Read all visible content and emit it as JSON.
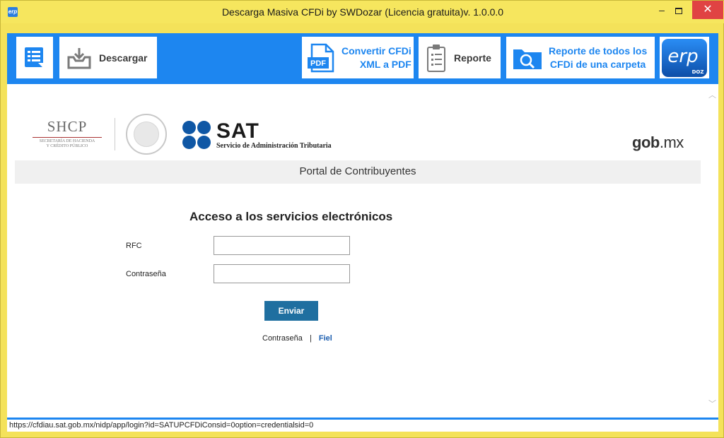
{
  "window": {
    "title": "Descarga Masiva CFDi by SWDozar (Licencia gratuita)v. 1.0.0.0",
    "app_icon_text": "erp",
    "minimize": "‒",
    "close": "✕"
  },
  "toolbar": {
    "descargar_label": "Descargar",
    "convertir_label_line1": "Convertir CFDi",
    "convertir_label_line2": "XML a PDF",
    "pdf_icon_text": "PDF",
    "reporte_label": "Reporte",
    "reporte_carpeta_line1": "Reporte de todos los",
    "reporte_carpeta_line2": "CFDi de una carpeta",
    "logo_text": "erp",
    "logo_sub": "DOZ"
  },
  "web": {
    "shcp_main": "SHCP",
    "shcp_sub1": "SECRETARÍA DE HACIENDA",
    "shcp_sub2": "Y CRÉDITO PÚBLICO",
    "sat_word": "SAT",
    "sat_sub": "Servicio de Administración Tributaria",
    "gob_prefix": "gob",
    "gob_suffix": ".mx",
    "portal_title": "Portal de Contribuyentes",
    "access_title": "Acceso a los servicios electrónicos",
    "rfc_label": "RFC",
    "rfc_value": "",
    "password_label": "Contraseña",
    "password_value": "",
    "send_button": "Enviar",
    "link_password": "Contraseña",
    "link_separator": "|",
    "link_fiel": "Fiel"
  },
  "status": {
    "url": "https://cfdiau.sat.gob.mx/nidp/app/login?id=SATUPCFDiConsid=0option=credentialsid=0"
  },
  "colors": {
    "accent": "#1d86f0",
    "frame": "#f4e25a",
    "sat_blue": "#0f57a5",
    "send_button": "#1f6fa0"
  }
}
